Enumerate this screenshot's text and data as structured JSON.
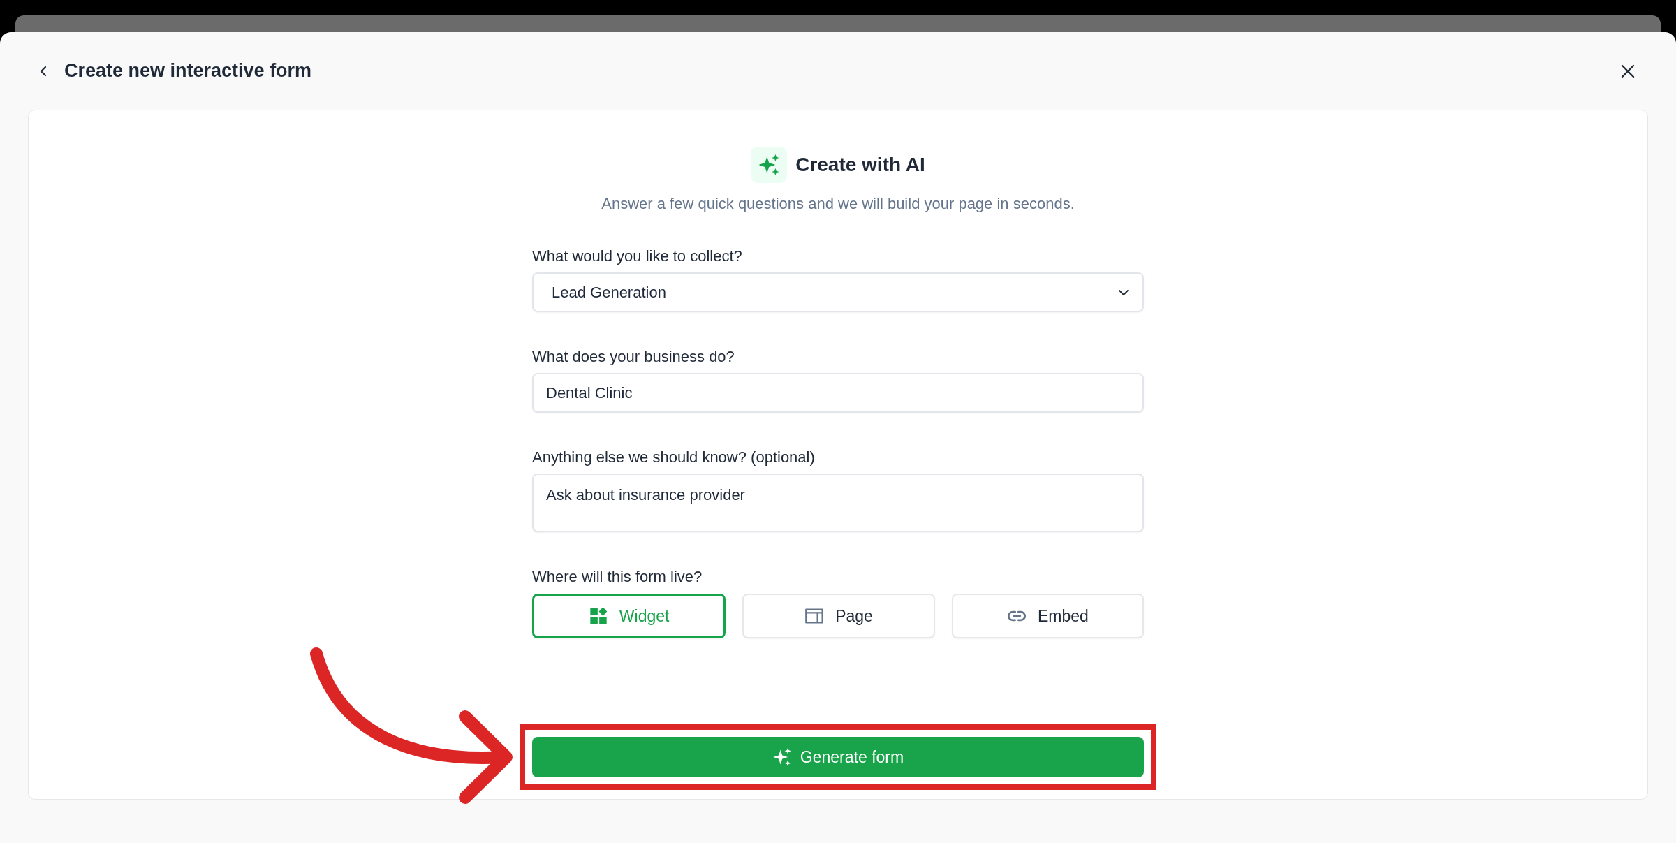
{
  "dialog": {
    "title": "Create new interactive form"
  },
  "intro": {
    "title": "Create with AI",
    "subtitle": "Answer a few quick questions and we will build your page in seconds."
  },
  "questions": [
    {
      "kind": "select",
      "label": "What would you like to collect?",
      "value": "Lead Generation"
    },
    {
      "kind": "input",
      "label": "What does your business do?",
      "value": "Dental Clinic"
    },
    {
      "kind": "textarea",
      "label": "Anything else we should know? (optional)",
      "value": "Ask about insurance provider"
    },
    {
      "kind": "choices",
      "label": "Where will this form live?",
      "options": [
        {
          "label": "Widget",
          "selected": true
        },
        {
          "label": "Page",
          "selected": false
        },
        {
          "label": "Embed",
          "selected": false
        }
      ]
    }
  ],
  "submit": {
    "label": "Generate form",
    "highlighted": true
  }
}
